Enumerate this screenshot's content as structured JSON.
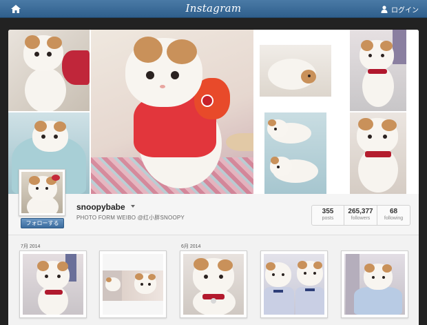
{
  "topbar": {
    "brand": "Instagram",
    "home_icon": "home-icon",
    "login_label": "ログイン",
    "login_icon": "user-icon"
  },
  "profile": {
    "username": "snoopybabe",
    "bio": "PHOTO FORM WEIBO @红小胖SNOOPY",
    "follow_label": "フォローする",
    "stats": [
      {
        "value": "355",
        "label": "posts"
      },
      {
        "value": "265,377",
        "label": "followers"
      },
      {
        "value": "68",
        "label": "following"
      }
    ]
  },
  "feed": {
    "months": [
      "7月 2014",
      "6月 2014"
    ]
  },
  "colors": {
    "topbar": "#3d6d9b",
    "follow_button": "#4a7aab",
    "card_bg": "#f2f2f2"
  }
}
